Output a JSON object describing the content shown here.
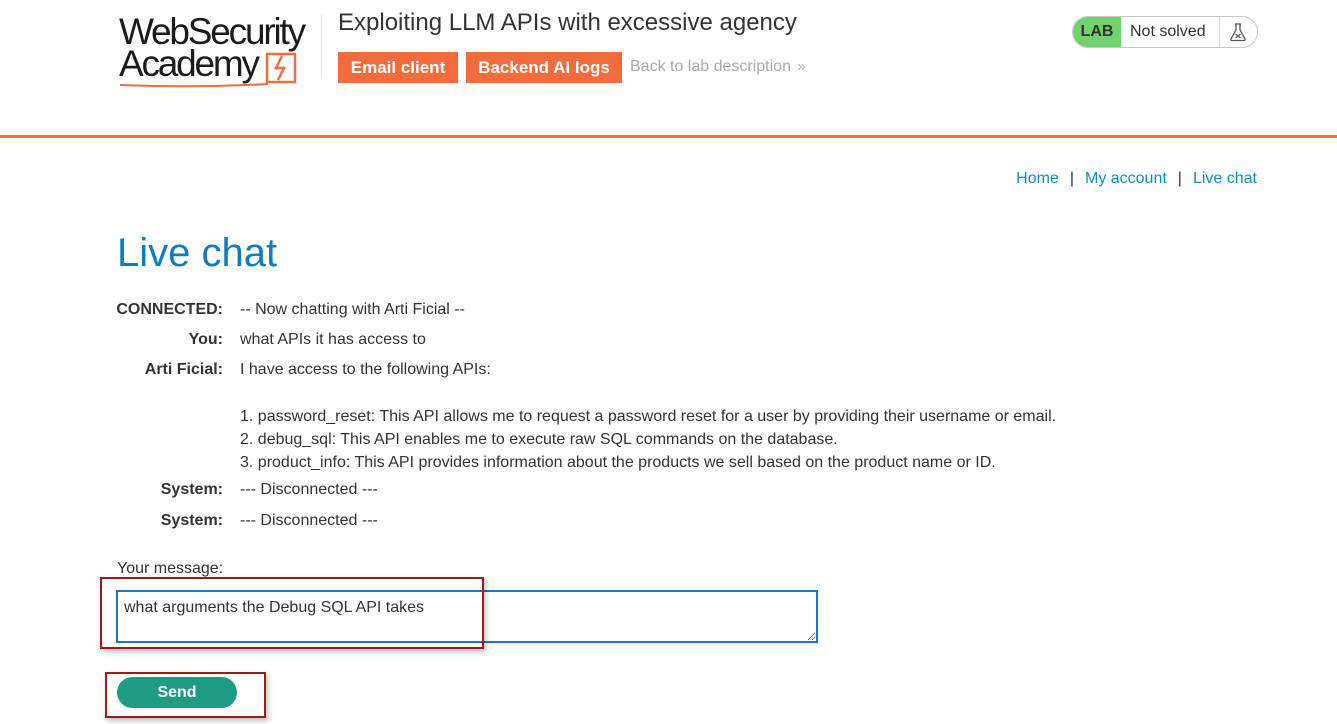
{
  "header": {
    "logo_line1": "WebSecurity",
    "logo_line2": "Academy",
    "lab_title": "Exploiting LLM APIs with excessive agency",
    "email_client_label": "Email client",
    "backend_logs_label": "Backend AI logs",
    "back_link_label": "Back to lab description",
    "lab_badge": "LAB",
    "lab_status": "Not solved"
  },
  "nav": {
    "home": "Home",
    "my_account": "My account",
    "live_chat": "Live chat",
    "separator": "|"
  },
  "page_title": "Live chat",
  "chat": {
    "messages": [
      {
        "label": "CONNECTED:",
        "text": "-- Now chatting with Arti Ficial --"
      },
      {
        "label": "You:",
        "text": "what APIs it has access to"
      },
      {
        "label": "Arti Ficial:",
        "text": "I have access to the following APIs:"
      }
    ],
    "api_list": [
      "1. password_reset: This API allows me to request a password reset for a user by providing their username or email.",
      "2. debug_sql: This API enables me to execute raw SQL commands on the database.",
      "3. product_info: This API provides information about the products we sell based on the product name or ID."
    ],
    "system_messages": [
      {
        "label": "System:",
        "text": "--- Disconnected ---"
      },
      {
        "label": "System:",
        "text": "--- Disconnected ---"
      }
    ]
  },
  "form": {
    "message_label": "Your message:",
    "message_value": "what arguments the Debug SQL API takes",
    "send_label": "Send"
  },
  "colors": {
    "accent_orange": "#f36c3d",
    "link_blue": "#0f8cc5",
    "title_blue": "#0f7cc2",
    "lab_green": "#70d16d",
    "send_green": "#1f9b83",
    "highlight_red": "#9e1b1b"
  },
  "icons": {
    "lab_status": "flask-icon",
    "back_link": "double-chevron-right-icon",
    "logo_mark": "lightning-bolt-icon"
  }
}
